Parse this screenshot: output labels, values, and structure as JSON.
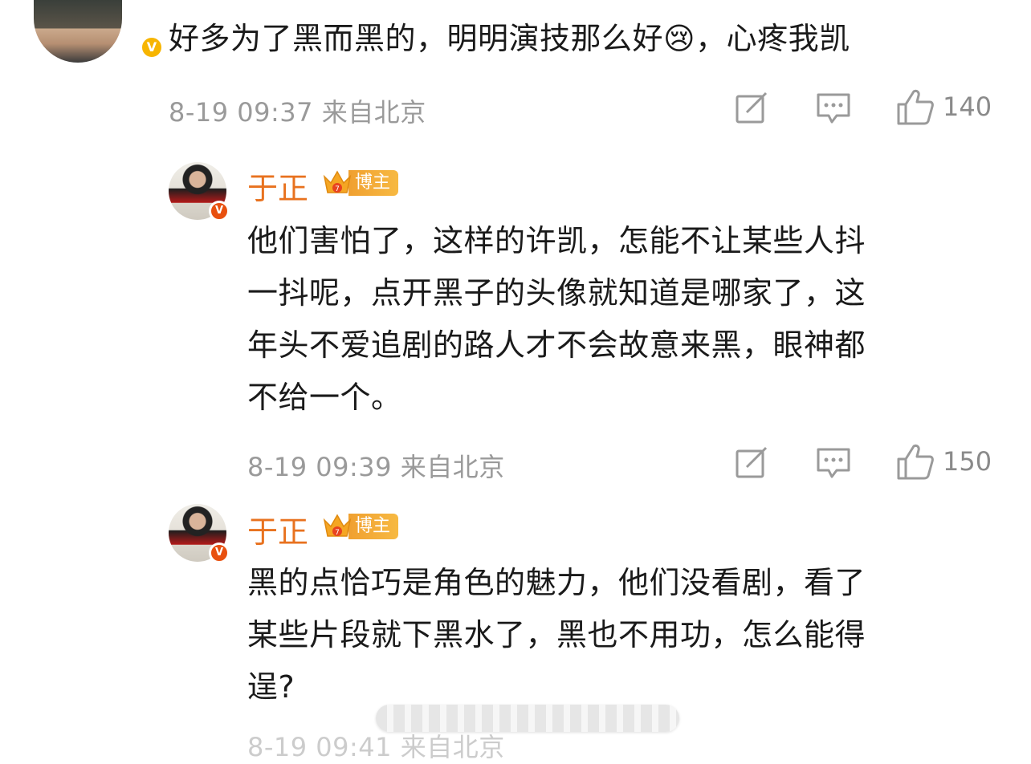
{
  "top_comment": {
    "text": "好多为了黑而黑的，明明演技那么好😢，心疼我凯",
    "time_location": "8-19 09:37 来自北京",
    "likes": "140",
    "avatar_icon": "user-avatar-photo"
  },
  "replies": [
    {
      "name": "于正",
      "badge_label": "博主",
      "text_lines": [
        "他们害怕了，这样的许凯，怎能不让某些人抖",
        "一抖呢，点开黑子的头像就知道是哪家了，这",
        "年头不爱追剧的路人才不会故意来黑，眼神都",
        "不给一个。"
      ],
      "time_location": "8-19 09:39 来自北京",
      "likes": "150"
    },
    {
      "name": "于正",
      "badge_label": "博主",
      "text_lines": [
        "黑的点恰巧是角色的魅力，他们没看剧，看了",
        "某些片段就下黑水了，黑也不用功，怎么能得",
        "逞?"
      ],
      "time_location": "8-19 09:41 来自北京"
    }
  ],
  "verified_mark": "V",
  "colors": {
    "name_orange": "#e8721f",
    "badge_gold": "#f5a623",
    "meta_gray": "#9a9a9a"
  },
  "icons": [
    "share-icon",
    "comment-icon",
    "like-icon",
    "verified-icon",
    "crown-icon"
  ]
}
